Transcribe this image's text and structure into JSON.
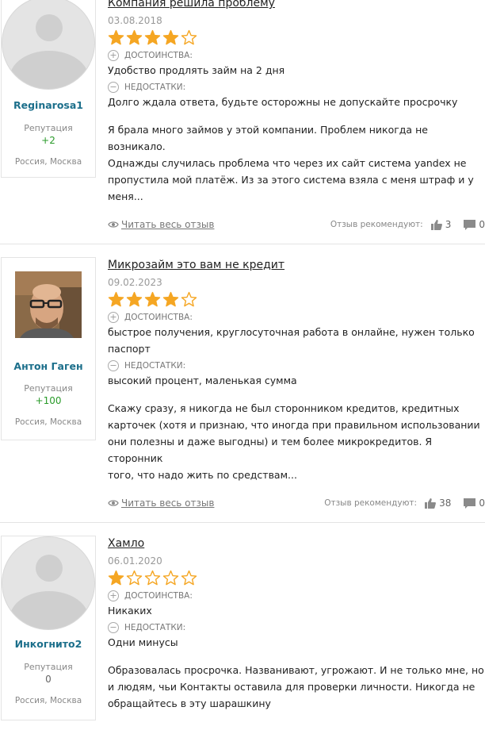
{
  "reviews": [
    {
      "author": {
        "name": "Reginarosa1",
        "avatar": "default-avatar",
        "reputation_label": "Репутация",
        "reputation": "+2",
        "location": "Россия, Москва"
      },
      "title": "Компания решила проблему",
      "date": "03.08.2018",
      "rating": 4,
      "pros_label": "ДОСТОИНСТВА:",
      "pros": "Удобство продлять займ на 2 дня",
      "cons_label": "НЕДОСТАТКИ:",
      "cons": "Долго ждала ответа, будьте осторожны не допускайте просрочку",
      "body": [
        "Я брала много займов у этой компании. Проблем никогда не возникало.",
        "Однажды случилась проблема что через их сайт система yandex не",
        "пропустила мой платёж. Из за этого система взяла с меня штраф и у",
        "меня..."
      ],
      "read_more": "Читать весь отзыв",
      "recommend_label": "Отзыв рекомендуют:",
      "likes": "3",
      "comments": "0"
    },
    {
      "author": {
        "name": "Антон Гаген",
        "avatar": "user-photo",
        "reputation_label": "Репутация",
        "reputation": "+100",
        "location": "Россия, Москва"
      },
      "title": "Микрозайм это вам не кредит",
      "date": "09.02.2023",
      "rating": 4,
      "pros_label": "ДОСТОИНСТВА:",
      "pros": [
        "быстрое получения, круглосуточная работа в онлайне, нужен только",
        "паспорт"
      ],
      "cons_label": "НЕДОСТАТКИ:",
      "cons": "высокий процент, маленькая сумма",
      "body": [
        "Скажу сразу, я никогда не был сторонником кредитов, кредитных",
        "карточек (хотя и признаю, что иногда при правильном использовании",
        "они полезны и даже выгодны) и тем более микрокредитов. Я сторонник",
        "того, что надо жить по средствам..."
      ],
      "read_more": "Читать весь отзыв",
      "recommend_label": "Отзыв рекомендуют:",
      "likes": "38",
      "comments": "0"
    },
    {
      "author": {
        "name": "Инкогнито2",
        "avatar": "default-avatar",
        "reputation_label": "Репутация",
        "reputation": "0",
        "location": "Россия, Москва"
      },
      "title": "Хамло",
      "date": "06.01.2020",
      "rating": 1,
      "pros_label": "ДОСТОИНСТВА:",
      "pros": "Никаких",
      "cons_label": "НЕДОСТАТКИ:",
      "cons": "Одни минусы",
      "body": [
        "Образовалась просрочка. Названивают, угрожают. И не только мне, но",
        "и людям, чьи Контакты оставила для проверки личности. Никогда не",
        "обращайтесь в эту шарашкину"
      ]
    }
  ],
  "colors": {
    "star": "#f5a623",
    "username": "#1c6f8b",
    "reputation_positive": "#2a9b2a"
  }
}
